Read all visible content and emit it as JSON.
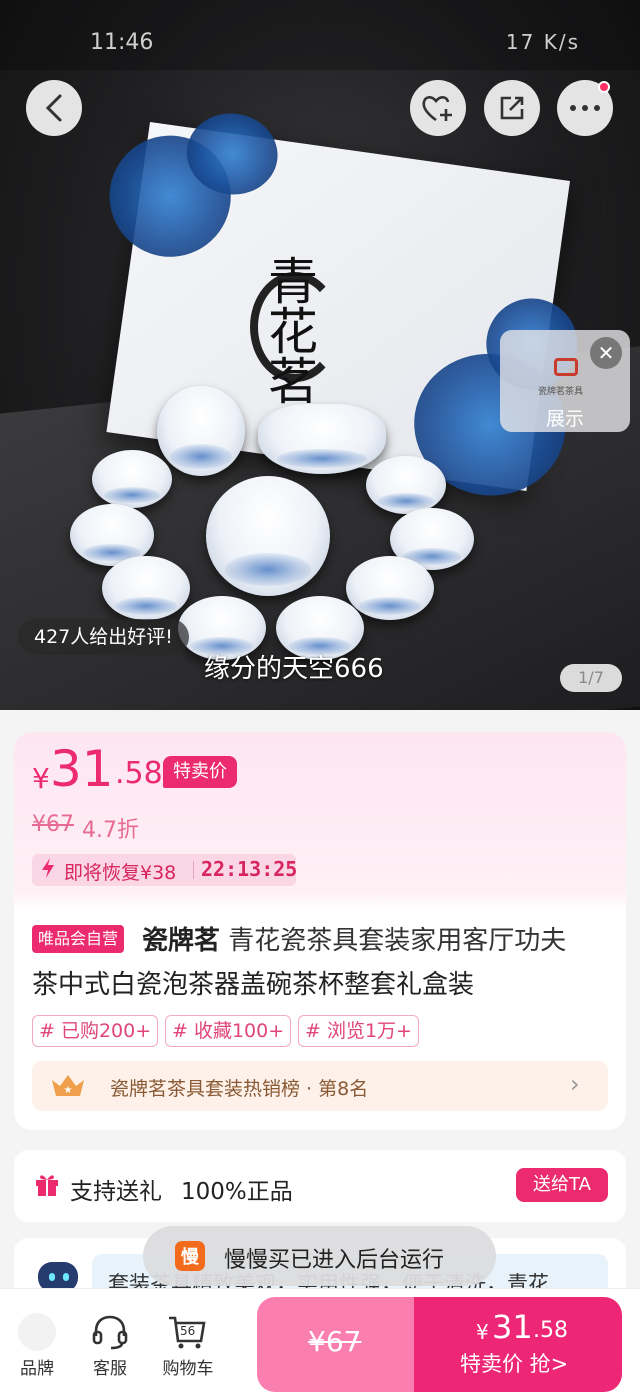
{
  "status_bar": {
    "time": "11:46",
    "net_speed": "17 K/s"
  },
  "hero": {
    "box_title": "青花茗",
    "shop_card_label": "展示",
    "shop_card_sub": "瓷牌茗茶具",
    "review_badge": "427人给出好评!",
    "danmaku": "缘分的天空666",
    "page_indicator": "1/7"
  },
  "price": {
    "currency": "¥",
    "integer": "31",
    "decimal": ".58",
    "tag": "特卖价",
    "original": "¥67",
    "discount": "4.7折",
    "restore_text": "即将恢复¥38",
    "countdown": "22:13:25"
  },
  "product": {
    "vip_tag": "唯品会自营",
    "brand": "瓷牌茗",
    "title_rest_line1": " 青花瓷茶具套装家用客厅功夫",
    "title_line2": "茶中式白瓷泡茶器盖碗茶杯整套礼盒装",
    "tags": [
      "已购200+",
      "收藏100+",
      "浏览1万+"
    ],
    "rank_text": "瓷牌茗茶具套装热销榜 · 第8名"
  },
  "gift": {
    "support_gift": "支持送礼",
    "genuine": "100%正品",
    "send_button": "送给TA"
  },
  "ai_intro": {
    "text": "套装茶具精致美观，实用性强，便于清洗，青花"
  },
  "toast": {
    "icon_char": "慢",
    "text": "慢慢买已进入后台运行"
  },
  "bottom_nav": {
    "brand_label": "品牌",
    "service_label": "客服",
    "cart_label": "购物车",
    "cart_count": "56"
  },
  "buy": {
    "original_price": "¥67",
    "currency": "¥",
    "price_int": "31",
    "price_dec": ".58",
    "label": "特卖价 抢>"
  },
  "colors": {
    "accent": "#ec2a6e",
    "buy_left": "#fb7eb0",
    "buy_right": "#ee2676",
    "toast_icon": "#f26b1d"
  }
}
